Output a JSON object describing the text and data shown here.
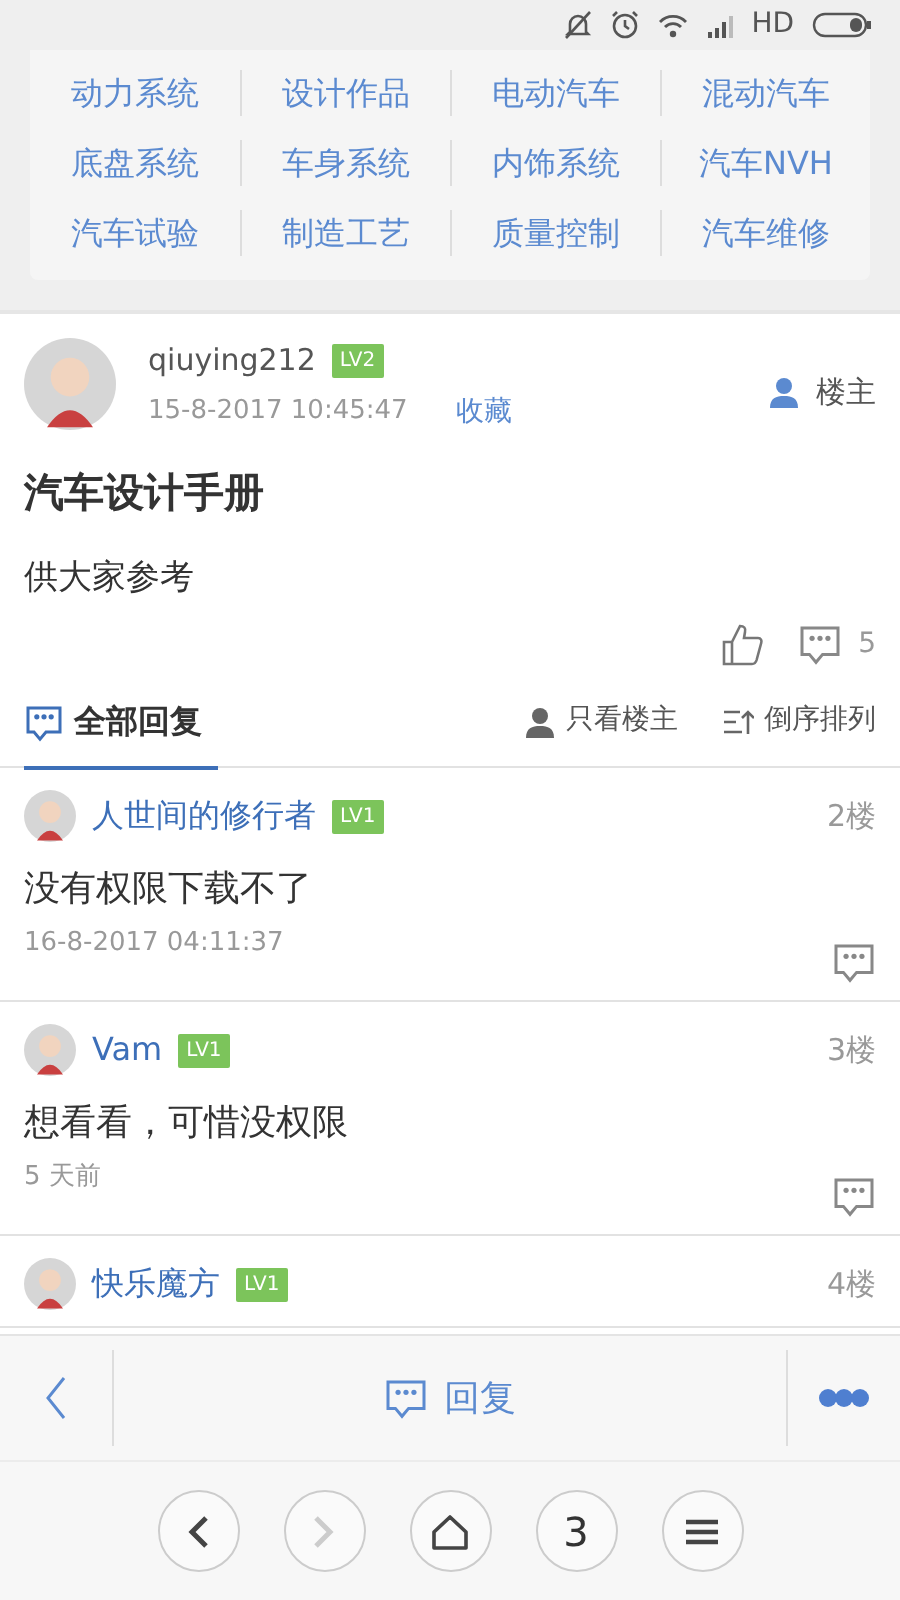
{
  "status_bar": {
    "network": "HD"
  },
  "categories": [
    "动力系统",
    "设计作品",
    "电动汽车",
    "混动汽车",
    "底盘系统",
    "车身系统",
    "内饰系统",
    "汽车NVH",
    "汽车试验",
    "制造工艺",
    "质量控制",
    "汽车维修"
  ],
  "post": {
    "author": "qiuying212",
    "level": "LV2",
    "time": "15-8-2017 10:45:47",
    "favorite": "收藏",
    "role": "楼主",
    "title": "汽车设计手册",
    "body": "供大家参考",
    "comment_count": "5"
  },
  "reply_tabs": [
    {
      "kind": "all",
      "label": "全部回复",
      "selected": true
    },
    {
      "kind": "owner",
      "label": "只看楼主",
      "selected": false
    },
    {
      "kind": "sort",
      "label": "倒序排列",
      "selected": false
    }
  ],
  "replies": [
    {
      "author": "人世间的修行者",
      "level": "LV1",
      "floor": "2楼",
      "text": "没有权限下载不了",
      "time": "16-8-2017 04:11:37"
    },
    {
      "author": "Vam",
      "level": "LV1",
      "floor": "3楼",
      "text": "想看看，可惜没权限",
      "time": "5 天前"
    },
    {
      "author": "快乐魔方",
      "level": "LV1",
      "floor": "4楼"
    }
  ],
  "bottom_bar": {
    "reply": "回复"
  },
  "browser_nav": [
    {
      "kind": "back",
      "disabled": false
    },
    {
      "kind": "forward",
      "disabled": true
    },
    {
      "kind": "home",
      "disabled": false
    },
    {
      "kind": "tabs",
      "label": "3",
      "disabled": false
    },
    {
      "kind": "menu",
      "disabled": false
    }
  ]
}
